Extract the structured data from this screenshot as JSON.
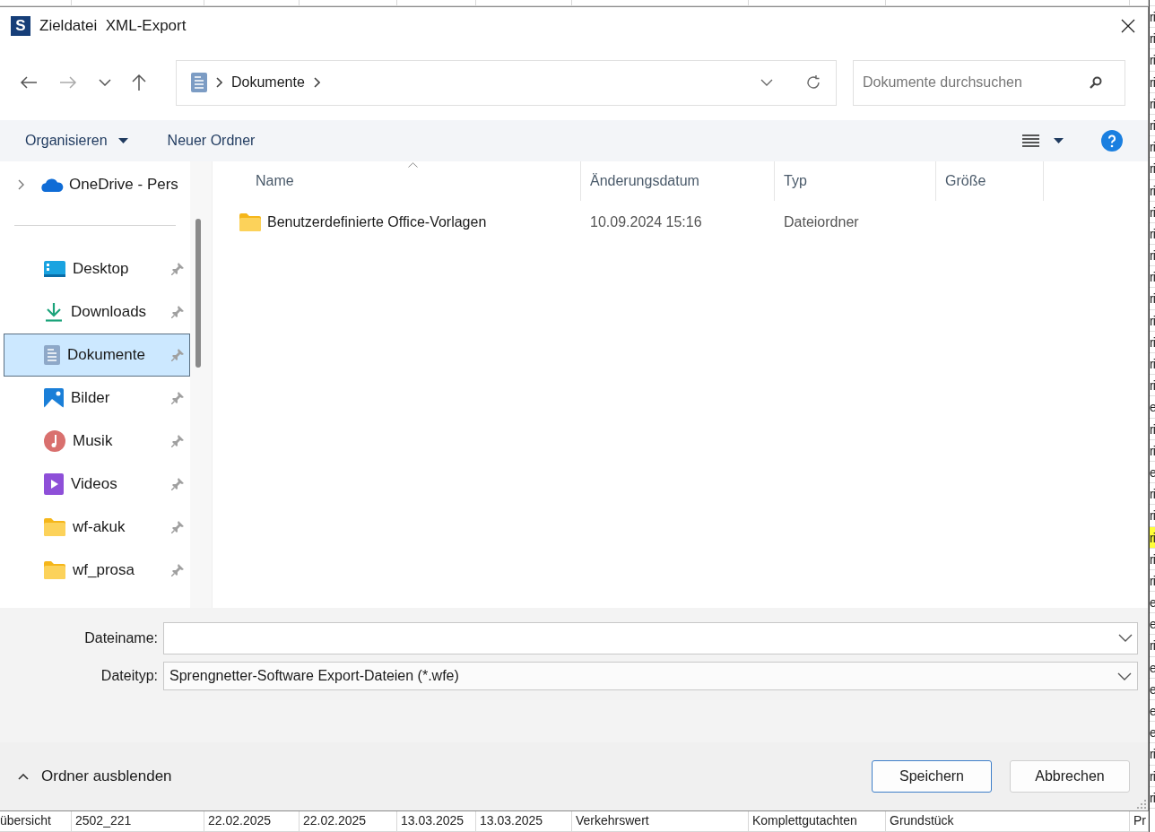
{
  "background_table": {
    "bottom_row": [
      "übersicht",
      "2502_221",
      "22.02.2025",
      "22.02.2025",
      "13.03.2025",
      "13.03.2025",
      "Verkehrswert",
      "Komplettgutachten",
      "Grundstück",
      "Pr"
    ],
    "right_edge_cells": [
      {
        "text": "ri",
        "highlighted": false
      },
      {
        "text": "ri",
        "highlighted": false
      },
      {
        "text": "ri",
        "highlighted": false
      },
      {
        "text": "ri",
        "highlighted": false
      },
      {
        "text": "ri",
        "highlighted": false
      },
      {
        "text": "ri",
        "highlighted": false
      },
      {
        "text": "ri",
        "highlighted": false
      },
      {
        "text": "ri",
        "highlighted": false
      },
      {
        "text": "ri",
        "highlighted": false
      },
      {
        "text": "ri",
        "highlighted": false
      },
      {
        "text": "ri",
        "highlighted": false
      },
      {
        "text": "ri",
        "highlighted": false
      },
      {
        "text": "ri",
        "highlighted": false
      },
      {
        "text": "ri",
        "highlighted": false
      },
      {
        "text": "ri",
        "highlighted": false
      },
      {
        "text": "ri",
        "highlighted": false
      },
      {
        "text": "ri",
        "highlighted": false
      },
      {
        "text": "ri",
        "highlighted": false
      },
      {
        "text": "e",
        "highlighted": false
      },
      {
        "text": "ri",
        "highlighted": false
      },
      {
        "text": "ri",
        "highlighted": false
      },
      {
        "text": "e",
        "highlighted": false
      },
      {
        "text": "ri",
        "highlighted": false
      },
      {
        "text": "ri",
        "highlighted": false
      },
      {
        "text": "ri",
        "highlighted": true
      },
      {
        "text": "ri",
        "highlighted": false
      },
      {
        "text": "ri",
        "highlighted": false
      },
      {
        "text": "e",
        "highlighted": false
      },
      {
        "text": "e",
        "highlighted": false
      },
      {
        "text": "ri",
        "highlighted": false
      },
      {
        "text": "e",
        "highlighted": false
      },
      {
        "text": "e",
        "highlighted": false
      },
      {
        "text": "e",
        "highlighted": false
      },
      {
        "text": "e",
        "highlighted": false
      },
      {
        "text": "ri",
        "highlighted": false
      },
      {
        "text": "ri",
        "highlighted": false
      },
      {
        "text": "ri",
        "highlighted": false
      }
    ]
  },
  "dialog": {
    "app_icon": "S",
    "title": "Zieldatei  XML-Export",
    "address": {
      "segments": [
        "Dokumente"
      ]
    },
    "search": {
      "placeholder": "Dokumente durchsuchen"
    },
    "commands": [
      {
        "label": "Organisieren",
        "dropdown": true
      },
      {
        "label": "Neuer Ordner",
        "dropdown": false
      }
    ],
    "sidebar": {
      "items": [
        {
          "label": "OneDrive - Pers",
          "kind": "cloud",
          "expandable": true,
          "pinned": false,
          "selected": false
        },
        {
          "label": "Desktop",
          "kind": "desktop",
          "expandable": false,
          "pinned": true,
          "selected": false
        },
        {
          "label": "Downloads",
          "kind": "download",
          "expandable": false,
          "pinned": true,
          "selected": false
        },
        {
          "label": "Dokumente",
          "kind": "document",
          "expandable": false,
          "pinned": true,
          "selected": true
        },
        {
          "label": "Bilder",
          "kind": "pictures",
          "expandable": false,
          "pinned": true,
          "selected": false
        },
        {
          "label": "Musik",
          "kind": "music",
          "expandable": false,
          "pinned": true,
          "selected": false
        },
        {
          "label": "Videos",
          "kind": "video",
          "expandable": false,
          "pinned": true,
          "selected": false
        },
        {
          "label": "wf-akuk",
          "kind": "folder",
          "expandable": false,
          "pinned": true,
          "selected": false
        },
        {
          "label": "wf_prosa",
          "kind": "folder",
          "expandable": false,
          "pinned": true,
          "selected": false
        }
      ]
    },
    "columns": [
      {
        "label": "Name",
        "sorted": true
      },
      {
        "label": "Änderungsdatum",
        "sorted": false
      },
      {
        "label": "Typ",
        "sorted": false
      },
      {
        "label": "Größe",
        "sorted": false
      }
    ],
    "files": [
      {
        "name": "Benutzerdefinierte Office-Vorlagen",
        "modified": "10.09.2024 15:16",
        "type": "Dateiordner"
      }
    ],
    "fields": [
      {
        "label": "Dateiname:",
        "kind": "input"
      },
      {
        "label": "Dateityp:",
        "kind": "select",
        "value": "Sprengnetter-Software Export-Dateien (*.wfe)"
      }
    ],
    "hide_folders": "Ordner ausblenden",
    "buttons": [
      {
        "label": "Speichern",
        "default": true
      },
      {
        "label": "Abbrechen",
        "default": false
      }
    ]
  }
}
